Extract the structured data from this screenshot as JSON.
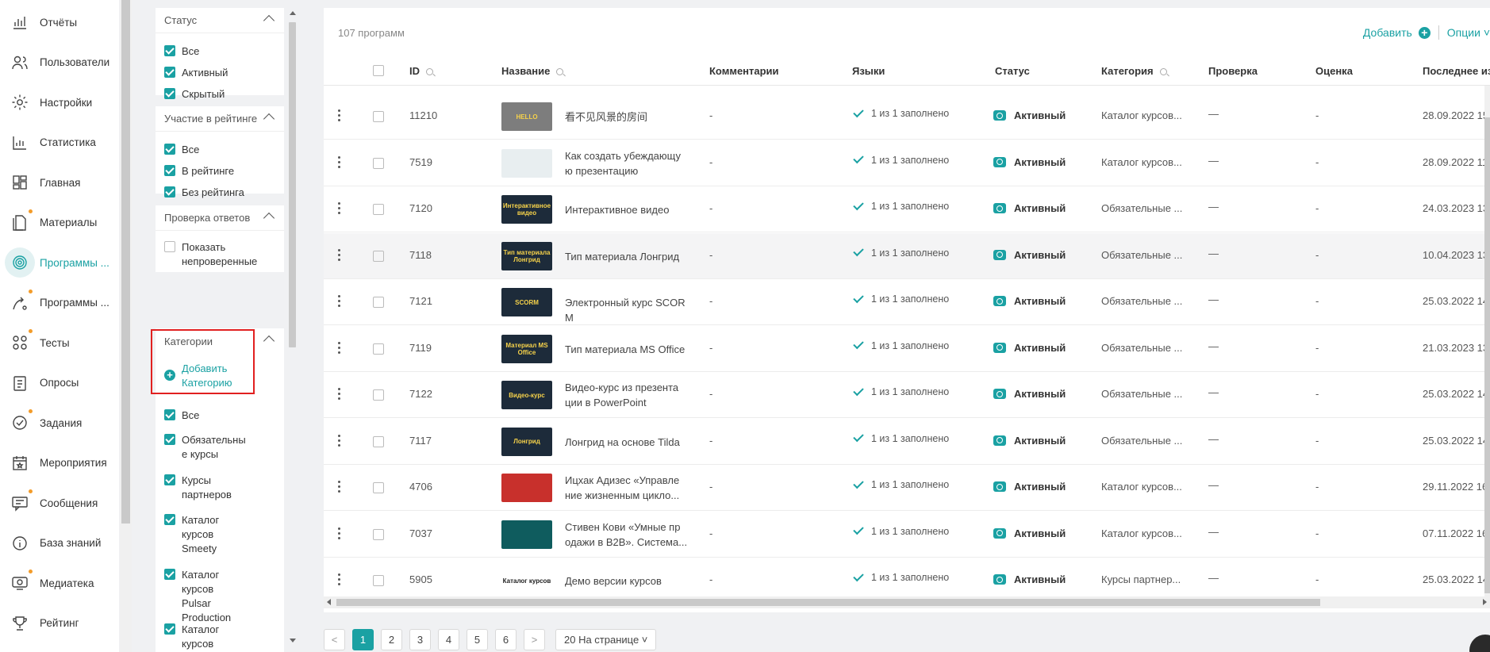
{
  "nav": {
    "items": [
      {
        "label": "Отчёты",
        "icon": "reports-icon",
        "dot": false,
        "active": false
      },
      {
        "label": "Пользователи",
        "icon": "users-icon",
        "dot": false,
        "active": false
      },
      {
        "label": "Настройки",
        "icon": "gear-icon",
        "dot": false,
        "active": false
      },
      {
        "label": "Статистика",
        "icon": "statistics-icon",
        "dot": false,
        "active": false
      },
      {
        "label": "Главная",
        "icon": "dashboard-icon",
        "dot": false,
        "active": false
      },
      {
        "label": "Материалы",
        "icon": "document-icon",
        "dot": true,
        "active": false
      },
      {
        "label": "Программы ...",
        "icon": "programs-icon",
        "dot": false,
        "active": true
      },
      {
        "label": "Программы ...",
        "icon": "route-icon",
        "dot": true,
        "active": false
      },
      {
        "label": "Тесты",
        "icon": "tests-icon",
        "dot": true,
        "active": false
      },
      {
        "label": "Опросы",
        "icon": "survey-icon",
        "dot": false,
        "active": false
      },
      {
        "label": "Задания",
        "icon": "task-icon",
        "dot": true,
        "active": false
      },
      {
        "label": "Мероприятия",
        "icon": "calendar-icon",
        "dot": false,
        "active": false
      },
      {
        "label": "Сообщения",
        "icon": "message-icon",
        "dot": true,
        "active": false
      },
      {
        "label": "База знаний",
        "icon": "info-icon",
        "dot": false,
        "active": false
      },
      {
        "label": "Медиатека",
        "icon": "media-icon",
        "dot": true,
        "active": false
      },
      {
        "label": "Рейтинг",
        "icon": "trophy-icon",
        "dot": false,
        "active": false
      }
    ]
  },
  "filters": {
    "status": {
      "title": "Статус",
      "options": [
        {
          "label": "Все",
          "checked": true
        },
        {
          "label": "Активный",
          "checked": true
        },
        {
          "label": "Скрытый",
          "checked": true
        }
      ]
    },
    "rating": {
      "title": "Участие в рейтинге",
      "options": [
        {
          "label": "Все",
          "checked": true
        },
        {
          "label": "В рейтинге",
          "checked": true
        },
        {
          "label": "Без рейтинга",
          "checked": true
        }
      ]
    },
    "review": {
      "title": "Проверка ответов",
      "options": [
        {
          "label": "Показать непроверенные",
          "checked": false
        }
      ]
    },
    "categories": {
      "title": "Категории",
      "add_label": "Добавить Категорию",
      "options": [
        {
          "label": "Все",
          "checked": true
        },
        {
          "label": "Обязательны е курсы",
          "checked": true
        },
        {
          "label": "Курсы партнеров",
          "checked": true
        },
        {
          "label": "Каталог курсов Smeety",
          "checked": true
        },
        {
          "label": "Каталог курсов Pulsar Production",
          "checked": true
        },
        {
          "label": "Каталог курсов",
          "checked": true
        }
      ]
    }
  },
  "table": {
    "count": "107 программ",
    "add_label": "Добавить",
    "options_label": "Опции ˅",
    "headers": {
      "id": "ID",
      "name": "Название",
      "comments": "Комментарии",
      "languages": "Языки",
      "status": "Статус",
      "category": "Категория",
      "check": "Проверка",
      "grade": "Оценка",
      "last": "Последнее из"
    },
    "rows": [
      {
        "id": "11210",
        "name": "看不见风景的房间",
        "comment": "-",
        "lang": "1 из 1 заполнено",
        "status": "Активный",
        "category": "Каталог курсов...",
        "check": "—",
        "grade": "-",
        "last": "28.09.2022 15",
        "thumb": "HELLO",
        "thumb_bg": "#7d7d7d"
      },
      {
        "id": "7519",
        "name": "Как создать убеждающу ю презентацию",
        "comment": "-",
        "lang": "1 из 1 заполнено",
        "status": "Активный",
        "category": "Каталог курсов...",
        "check": "—",
        "grade": "-",
        "last": "28.09.2022 11",
        "thumb": "",
        "thumb_bg": "#e8eef0"
      },
      {
        "id": "7120",
        "name": "Интерактивное видео",
        "comment": "-",
        "lang": "1 из 1 заполнено",
        "status": "Активный",
        "category": "Обязательные ...",
        "check": "—",
        "grade": "-",
        "last": "24.03.2023 13",
        "thumb": "Интерактивное видео",
        "thumb_bg": "#1d2b3a"
      },
      {
        "id": "7118",
        "name": "Тип материала Лонгрид",
        "comment": "-",
        "lang": "1 из 1 заполнено",
        "status": "Активный",
        "category": "Обязательные ...",
        "check": "—",
        "grade": "-",
        "last": "10.04.2023 13",
        "thumb": "Тип материала Лонгрид",
        "thumb_bg": "#1d2b3a"
      },
      {
        "id": "7121",
        "name": "Электронный курс SCOR M",
        "comment": "-",
        "lang": "1 из 1 заполнено",
        "status": "Активный",
        "category": "Обязательные ...",
        "check": "—",
        "grade": "-",
        "last": "25.03.2022 14",
        "thumb": "SCORM",
        "thumb_bg": "#1d2b3a"
      },
      {
        "id": "7119",
        "name": "Тип материала MS Office",
        "comment": "-",
        "lang": "1 из 1 заполнено",
        "status": "Активный",
        "category": "Обязательные ...",
        "check": "—",
        "grade": "-",
        "last": "21.03.2023 13",
        "thumb": "Материал MS Office",
        "thumb_bg": "#1d2b3a"
      },
      {
        "id": "7122",
        "name": "Видео-курс из презента ции в PowerPoint",
        "comment": "-",
        "lang": "1 из 1 заполнено",
        "status": "Активный",
        "category": "Обязательные ...",
        "check": "—",
        "grade": "-",
        "last": "25.03.2022 14",
        "thumb": "Видео-курс",
        "thumb_bg": "#1d2b3a"
      },
      {
        "id": "7117",
        "name": "Лонгрид на основе Tilda",
        "comment": "-",
        "lang": "1 из 1 заполнено",
        "status": "Активный",
        "category": "Обязательные ...",
        "check": "—",
        "grade": "-",
        "last": "25.03.2022 14",
        "thumb": "Лонгрид",
        "thumb_bg": "#1d2b3a"
      },
      {
        "id": "4706",
        "name": "Ицхак Адизес «Управле ние жизненным цикло...",
        "comment": "-",
        "lang": "1 из 1 заполнено",
        "status": "Активный",
        "category": "Каталог курсов...",
        "check": "—",
        "grade": "-",
        "last": "29.11.2022 16",
        "thumb": "",
        "thumb_bg": "#c8302c"
      },
      {
        "id": "7037",
        "name": "Стивен Кови «Умные пр одажи в B2B». Система...",
        "comment": "-",
        "lang": "1 из 1 заполнено",
        "status": "Активный",
        "category": "Каталог курсов...",
        "check": "—",
        "grade": "-",
        "last": "07.11.2022 16",
        "thumb": "",
        "thumb_bg": "#0f5c5e"
      },
      {
        "id": "5905",
        "name": "Демо версии курсов",
        "comment": "-",
        "lang": "1 из 1 заполнено",
        "status": "Активный",
        "category": "Курсы партнер...",
        "check": "—",
        "grade": "-",
        "last": "25.03.2022 14",
        "thumb": "Каталог курсов",
        "thumb_bg": "#ffffff"
      }
    ]
  },
  "pagination": {
    "pages": [
      "1",
      "2",
      "3",
      "4",
      "5",
      "6"
    ],
    "active": "1",
    "prev": "<",
    "next": ">",
    "per_page": "20 На странице ˅"
  },
  "colors": {
    "accent": "#1aa1a3",
    "dot": "#f39c2a",
    "highlight": "#e12020"
  }
}
